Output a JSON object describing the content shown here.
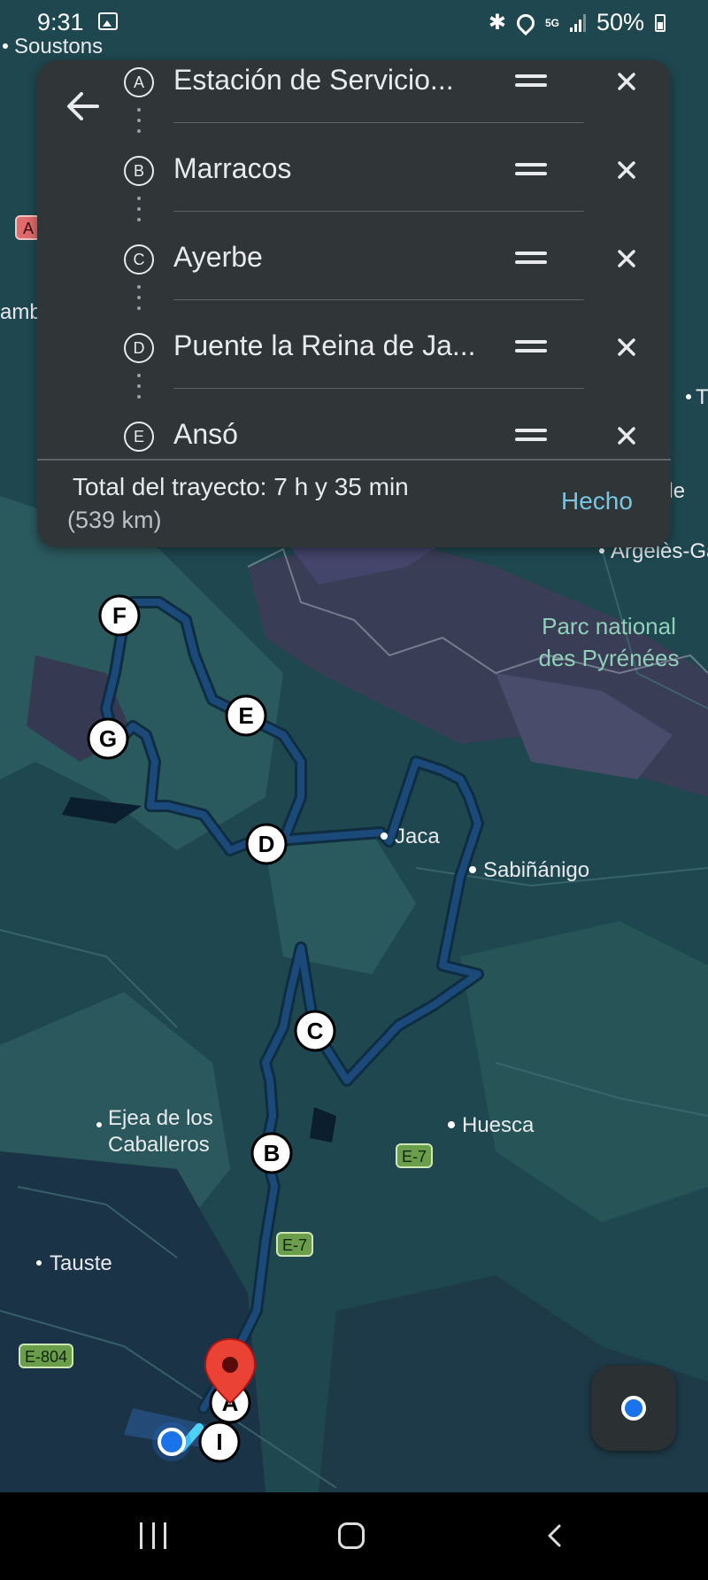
{
  "status_bar": {
    "time": "9:31",
    "network": "5G",
    "battery": "50%"
  },
  "route_panel": {
    "stops": [
      {
        "letter": "A",
        "name": "Estación de Servicio..."
      },
      {
        "letter": "B",
        "name": "Marracos"
      },
      {
        "letter": "C",
        "name": "Ayerbe"
      },
      {
        "letter": "D",
        "name": "Puente la Reina de Ja..."
      },
      {
        "letter": "E",
        "name": "Ansó"
      }
    ],
    "total_label": "Total del trayecto: 7 h y 35 min",
    "distance": "(539 km)",
    "done_button": "Hecho"
  },
  "map": {
    "places": {
      "soustons": "Soustons",
      "amb": "amb",
      "urde": "urde",
      "arreles": "Argelès-Ga",
      "t_right": "T",
      "parc_line1": "Parc national",
      "parc_line2": "des Pyrénées",
      "jaca": "Jaca",
      "sabinanigo": "Sabiñánigo",
      "huesca": "Huesca",
      "ejea_line1": "Ejea de los",
      "ejea_line2": "Caballeros",
      "tauste": "Tauste"
    },
    "road_badges": {
      "e7_a": "E-7",
      "e7_b": "E-7",
      "e804": "E-804",
      "a_left": "A"
    },
    "route_markers": {
      "a": "A",
      "b": "B",
      "c": "C",
      "d": "D",
      "e": "E",
      "f": "F",
      "g": "G",
      "i": "I"
    },
    "colors": {
      "route": "#1b4a7a",
      "route_outline": "#0f2d40",
      "water": "#0a1f33",
      "terrain": "#3b3f55",
      "land": "#204a50",
      "marker": "#ea4335"
    }
  }
}
